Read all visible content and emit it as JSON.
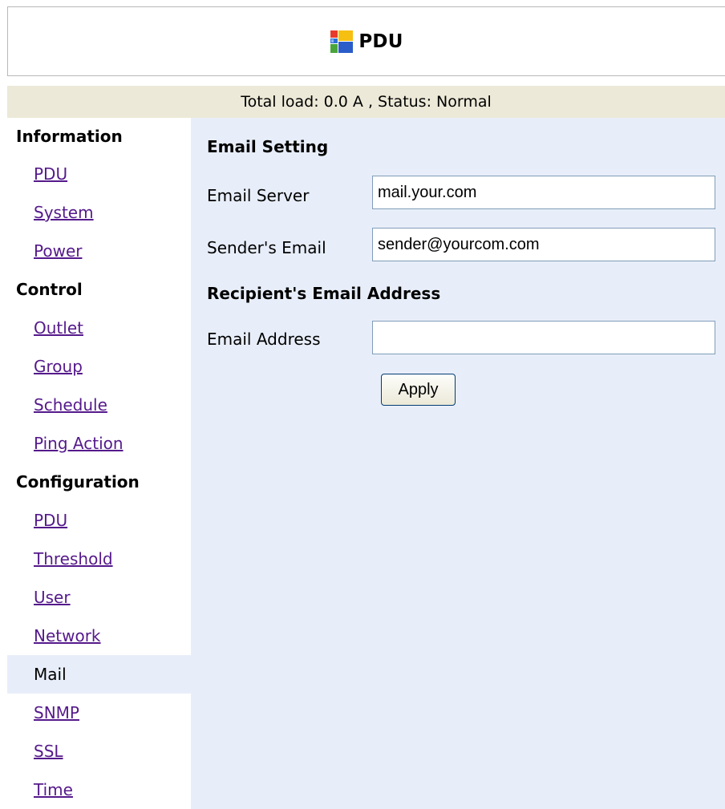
{
  "header": {
    "title": "PDU",
    "logo_icon": "windows-style-logo-icon"
  },
  "status_bar": {
    "text": "Total load: 0.0 A , Status: Normal"
  },
  "sidebar": {
    "sections": [
      {
        "label": "Information",
        "items": [
          {
            "label": "PDU",
            "active": false
          },
          {
            "label": "System",
            "active": false
          },
          {
            "label": "Power",
            "active": false
          }
        ]
      },
      {
        "label": "Control",
        "items": [
          {
            "label": "Outlet",
            "active": false
          },
          {
            "label": "Group",
            "active": false
          },
          {
            "label": "Schedule",
            "active": false
          },
          {
            "label": "Ping Action",
            "active": false
          }
        ]
      },
      {
        "label": "Configuration",
        "items": [
          {
            "label": "PDU",
            "active": false
          },
          {
            "label": "Threshold",
            "active": false
          },
          {
            "label": "User",
            "active": false
          },
          {
            "label": "Network",
            "active": false
          },
          {
            "label": "Mail",
            "active": true
          },
          {
            "label": "SNMP",
            "active": false
          },
          {
            "label": "SSL",
            "active": false
          },
          {
            "label": "Time",
            "active": false
          }
        ]
      }
    ]
  },
  "main": {
    "email_setting_title": "Email Setting",
    "email_server_label": "Email Server",
    "email_server_value": "mail.your.com",
    "sender_email_label": "Sender's Email",
    "sender_email_value": "sender@yourcom.com",
    "recipient_title": "Recipient's Email Address",
    "email_address_label": "Email Address",
    "email_address_value": "",
    "apply_label": "Apply"
  },
  "colors": {
    "status_bar_bg": "#ece9d8",
    "content_bg": "#e8eef9",
    "link_color": "#551a8b"
  }
}
